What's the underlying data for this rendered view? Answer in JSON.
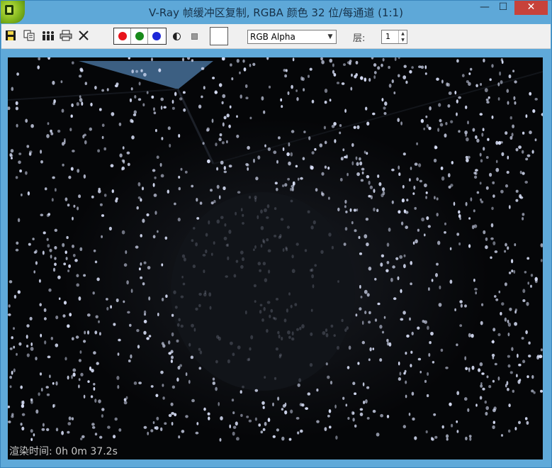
{
  "window": {
    "title": "V-Ray 帧缓冲区复制, RGBA 颜色 32 位/每通道 (1:1)",
    "minimize_glyph": "—",
    "maximize_glyph": "☐",
    "close_glyph": "✕"
  },
  "toolbar": {
    "icons": [
      "save-icon",
      "copy-icon",
      "clone-icon",
      "print-icon",
      "clear-icon"
    ],
    "channels": [
      {
        "name": "red-channel",
        "color": "#e8141b"
      },
      {
        "name": "green-channel",
        "color": "#188a1a"
      },
      {
        "name": "blue-channel",
        "color": "#1d27d8"
      }
    ],
    "swatch_color": "#ffffff",
    "channel_select_value": "RGB Alpha",
    "layer_label": "层:",
    "layer_value": "1"
  },
  "render": {
    "time_label": "渲染时间:  0h  0m 37.2s"
  },
  "colors": {
    "titlebar": "#5ea8d8",
    "close_button": "#c7423a",
    "render_background": "#050608",
    "speckle": "#dfe6ff"
  }
}
